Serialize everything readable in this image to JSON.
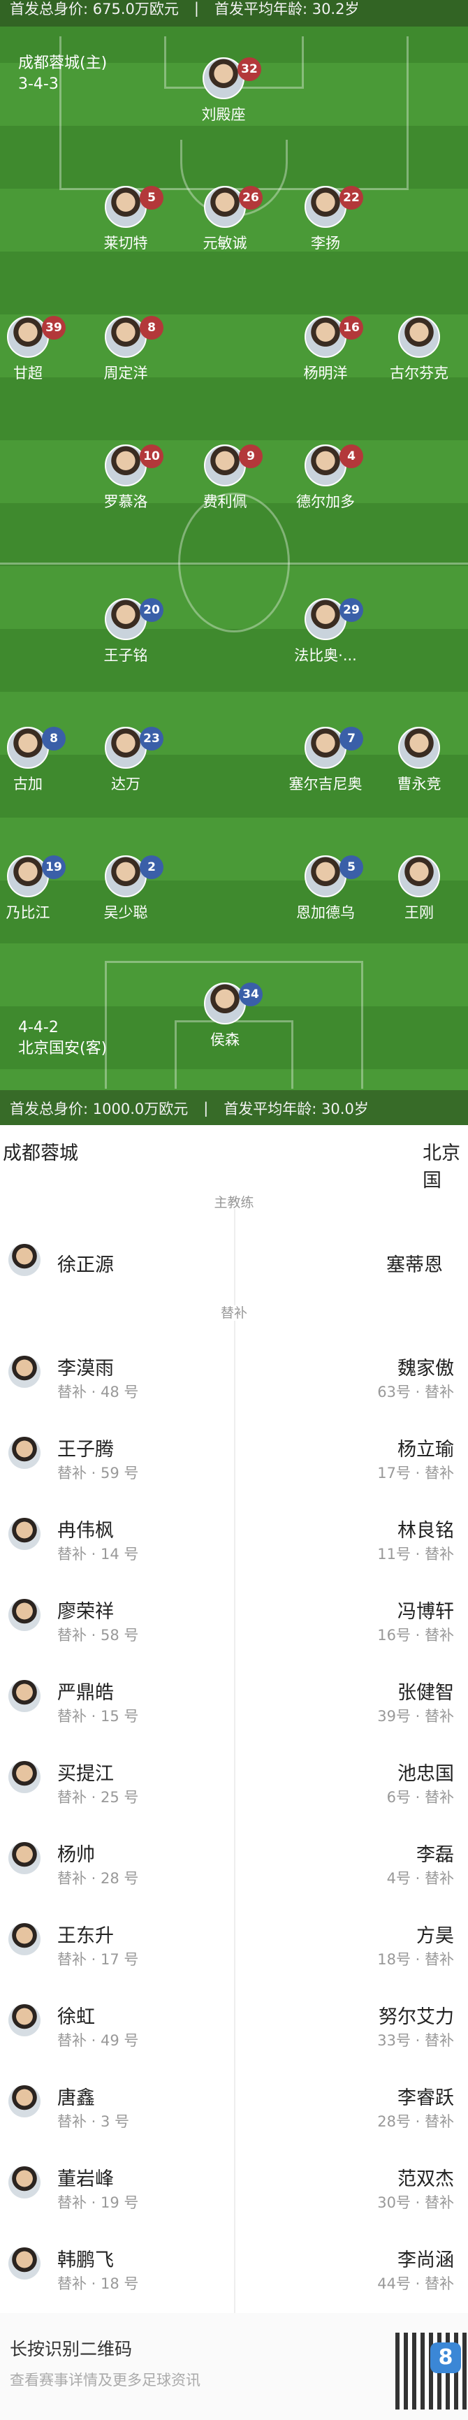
{
  "top_bar": {
    "value": "首发总身价: 675.0万欧元",
    "age": "首发平均年龄: 30.2岁"
  },
  "home": {
    "name": "成都蓉城(主)",
    "formation": "3-4-3"
  },
  "away": {
    "name": "北京国安(客)",
    "formation": "4-4-2"
  },
  "bottom_bar": {
    "value": "首发总身价: 1000.0万欧元",
    "age": "首发平均年龄: 30.0岁"
  },
  "home_players": [
    {
      "name": "刘殿座",
      "number": "32"
    },
    {
      "name": "莱切特",
      "number": "5"
    },
    {
      "name": "元敏诚",
      "number": "26"
    },
    {
      "name": "李扬",
      "number": "22"
    },
    {
      "name": "甘超",
      "number": "39"
    },
    {
      "name": "周定洋",
      "number": "8"
    },
    {
      "name": "杨明洋",
      "number": "16"
    },
    {
      "name": "古尔芬克",
      "number": ""
    },
    {
      "name": "罗慕洛",
      "number": "10"
    },
    {
      "name": "费利佩",
      "number": "9"
    },
    {
      "name": "德尔加多",
      "number": "4"
    }
  ],
  "away_players": [
    {
      "name": "王子铭",
      "number": "20"
    },
    {
      "name": "法比奥·...",
      "number": "29"
    },
    {
      "name": "古加",
      "number": "8"
    },
    {
      "name": "达万",
      "number": "23"
    },
    {
      "name": "塞尔吉尼奥",
      "number": "7"
    },
    {
      "name": "曹永竞",
      "number": ""
    },
    {
      "name": "乃比江",
      "number": "19"
    },
    {
      "name": "吴少聪",
      "number": "2"
    },
    {
      "name": "恩加德乌",
      "number": "5"
    },
    {
      "name": "王刚",
      "number": ""
    },
    {
      "name": "侯森",
      "number": "34"
    }
  ],
  "lists": {
    "home_team": "成都蓉城",
    "away_team": "北京国",
    "coach_label": "主教练",
    "home_coach": "徐正源",
    "away_coach": "塞蒂恩",
    "subs_label": "替补",
    "home_subs": [
      {
        "name": "李漠雨",
        "info": "替补 · 48 号"
      },
      {
        "name": "王子腾",
        "info": "替补 · 59 号"
      },
      {
        "name": "冉伟枫",
        "info": "替补 · 14 号"
      },
      {
        "name": "廖荣祥",
        "info": "替补 · 58 号"
      },
      {
        "name": "严鼎皓",
        "info": "替补 · 15 号"
      },
      {
        "name": "买提江",
        "info": "替补 · 25 号"
      },
      {
        "name": "杨帅",
        "info": "替补 · 28 号"
      },
      {
        "name": "王东升",
        "info": "替补 · 17 号"
      },
      {
        "name": "徐虹",
        "info": "替补 · 49 号"
      },
      {
        "name": "唐鑫",
        "info": "替补 · 3 号"
      },
      {
        "name": "董岩峰",
        "info": "替补 · 19 号"
      },
      {
        "name": "韩鹏飞",
        "info": "替补 · 18 号"
      }
    ],
    "away_subs": [
      {
        "name": "魏家傲",
        "info": "63号 · 替补"
      },
      {
        "name": "杨立瑜",
        "info": "17号 · 替补"
      },
      {
        "name": "林良铭",
        "info": "11号 · 替补"
      },
      {
        "name": "冯博轩",
        "info": "16号 · 替补"
      },
      {
        "name": "张健智",
        "info": "39号 · 替补"
      },
      {
        "name": "池忠国",
        "info": "6号 · 替补"
      },
      {
        "name": "李磊",
        "info": "4号 · 替补"
      },
      {
        "name": "方昊",
        "info": "18号 · 替补"
      },
      {
        "name": "努尔艾力",
        "info": "33号 · 替补"
      },
      {
        "name": "李睿跃",
        "info": "28号 · 替补"
      },
      {
        "name": "范双杰",
        "info": "30号 · 替补"
      },
      {
        "name": "李尚涵",
        "info": "44号 · 替补"
      }
    ]
  },
  "footer": {
    "title": "长按识别二维码",
    "subtitle": "查看赛事详情及更多足球资讯",
    "badge": "8"
  },
  "colors": {
    "home_badge": "#b3383a",
    "away_badge": "#3a5fa8",
    "pitch": "#3f8a2e"
  }
}
